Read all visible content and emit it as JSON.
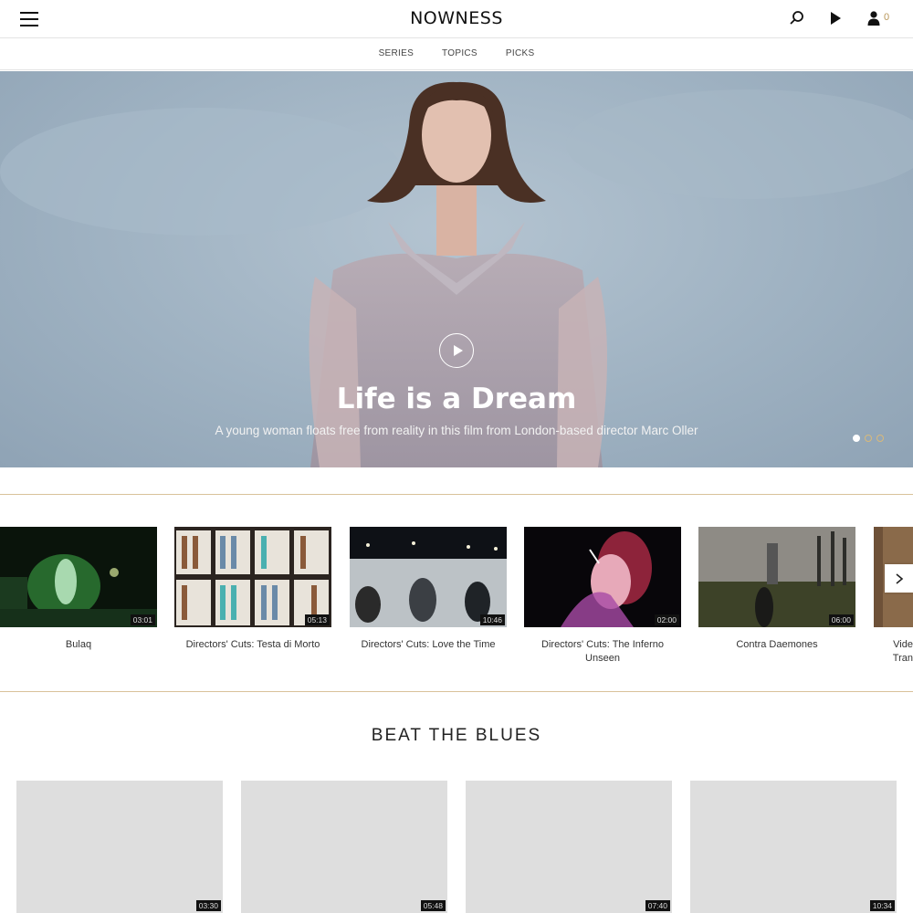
{
  "header": {
    "logo": "NOWNESS",
    "icons": [
      "menu-icon",
      "search-icon",
      "play-icon",
      "user-icon"
    ],
    "user_count": "0"
  },
  "subnav": {
    "items": [
      "SERIES",
      "TOPICS",
      "PICKS"
    ]
  },
  "hero": {
    "title": "Life is a Dream",
    "subtitle": "A young woman floats free from reality in this film from London-based director Marc Oller",
    "slide_count": 3,
    "active_slide": 1
  },
  "carousel": {
    "items": [
      {
        "title": "Bulaq",
        "duration": "03:01"
      },
      {
        "title": "Directors' Cuts: Testa di Morto",
        "duration": "05:13"
      },
      {
        "title": "Directors' Cuts: Love the Time",
        "duration": "10:46"
      },
      {
        "title": "Directors' Cuts: The Inferno Unseen",
        "duration": "02:00"
      },
      {
        "title": "Contra Daemones",
        "duration": "06:00"
      },
      {
        "title": "Vide\nTran",
        "duration": ""
      }
    ]
  },
  "section": {
    "title": "BEAT THE BLUES",
    "cards": [
      {
        "duration": "03:30"
      },
      {
        "duration": "05:48"
      },
      {
        "duration": "07:40"
      },
      {
        "duration": "10:34"
      }
    ]
  },
  "colors": {
    "accent": "#b8975a",
    "rule": "#d9c29a",
    "placeholder": "#dedede"
  }
}
